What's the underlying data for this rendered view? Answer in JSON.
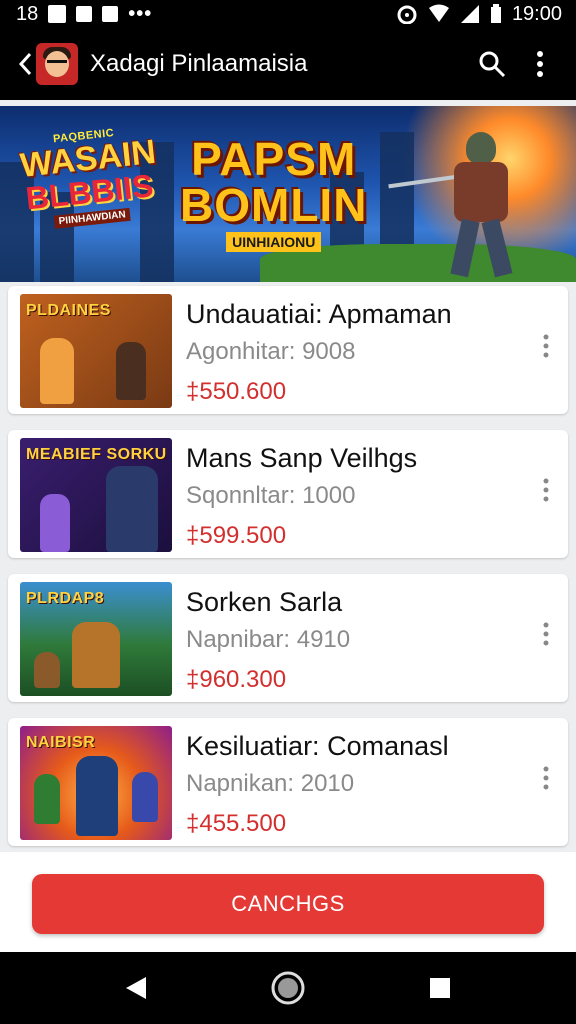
{
  "status_bar": {
    "time_left": "18",
    "time_right": "19:00",
    "overflow": "•••"
  },
  "app_bar": {
    "title": "Xadagi Pinlaamaisia",
    "icons": [
      "back-arrow-icon",
      "app-avatar",
      "search-icon",
      "more-vert-icon"
    ]
  },
  "banner": {
    "logo_small": "PAQBENIC",
    "logo_line1": "WASAIN",
    "logo_line2": "BLBBIIS",
    "logo_sub": "PIINHAWDIAN",
    "title_line1": "PAPSM",
    "title_line2": "BOMLIN",
    "subtitle": "UINHIAIONU"
  },
  "items": [
    {
      "thumb_title": "PLDAINES",
      "title": "Undauatiai: Apmaman",
      "subtitle": "Agonhitar: 9008",
      "price": "‡550.600",
      "colors": [
        "#c0611f",
        "#7a3a14",
        "#f0a040"
      ]
    },
    {
      "thumb_title": "MEABIEF SORKU",
      "title": "Mans Sanp Veilhgs",
      "subtitle": "Sqonnltar: 1000",
      "price": "‡599.500",
      "colors": [
        "#3a1e6e",
        "#1b0f3d",
        "#8a5cd6"
      ]
    },
    {
      "thumb_title": "PLRDAP8",
      "title": "Sorken Sarla",
      "subtitle": "Napnibar: 4910",
      "price": "‡960.300",
      "colors": [
        "#2f7a3a",
        "#1c4f24",
        "#5cb85c"
      ]
    },
    {
      "thumb_title": "NAIBISR",
      "title": "Kesiluatiar: Comanasl",
      "subtitle": "Napnikan: 2010",
      "price": "‡455.500",
      "colors": [
        "#e65a1a",
        "#8e1f8a",
        "#ffb347"
      ]
    }
  ],
  "cta": {
    "label": "CANCHGS"
  },
  "nav": {
    "icons": [
      "back-triangle-icon",
      "home-circle-icon",
      "recents-square-icon"
    ]
  },
  "colors": {
    "accent": "#e53935",
    "price": "#d32f2f",
    "background": "#eceef0"
  }
}
